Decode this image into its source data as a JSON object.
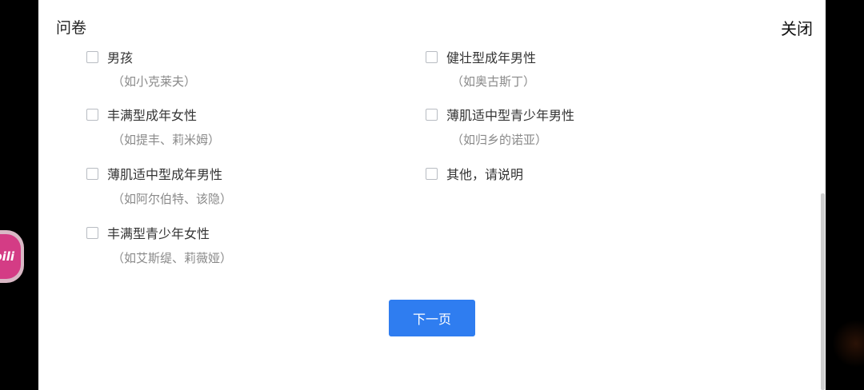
{
  "header": {
    "title": "问卷",
    "close_label": "关闭"
  },
  "options_left": [
    {
      "label": "男孩",
      "example": "（如小克莱夫）"
    },
    {
      "label": "丰满型成年女性",
      "example": "（如提丰、莉米姆）"
    },
    {
      "label": "薄肌适中型成年男性",
      "example": "（如阿尔伯特、该隐）"
    },
    {
      "label": "丰满型青少年女性",
      "example": "（如艾斯缇、莉薇娅）"
    }
  ],
  "options_right": [
    {
      "label": "健壮型成年男性",
      "example": "（如奥古斯丁）"
    },
    {
      "label": "薄肌适中型青少年男性",
      "example": "（如归乡的诺亚）"
    },
    {
      "label": "其他，请说明"
    }
  ],
  "next_button_label": "下一页",
  "floating_app": {
    "label": "bili",
    "icon": "bilibili-icon",
    "color": "#d43c85"
  },
  "colors": {
    "accent": "#2f7df0",
    "example_text": "#8a8a8a"
  }
}
